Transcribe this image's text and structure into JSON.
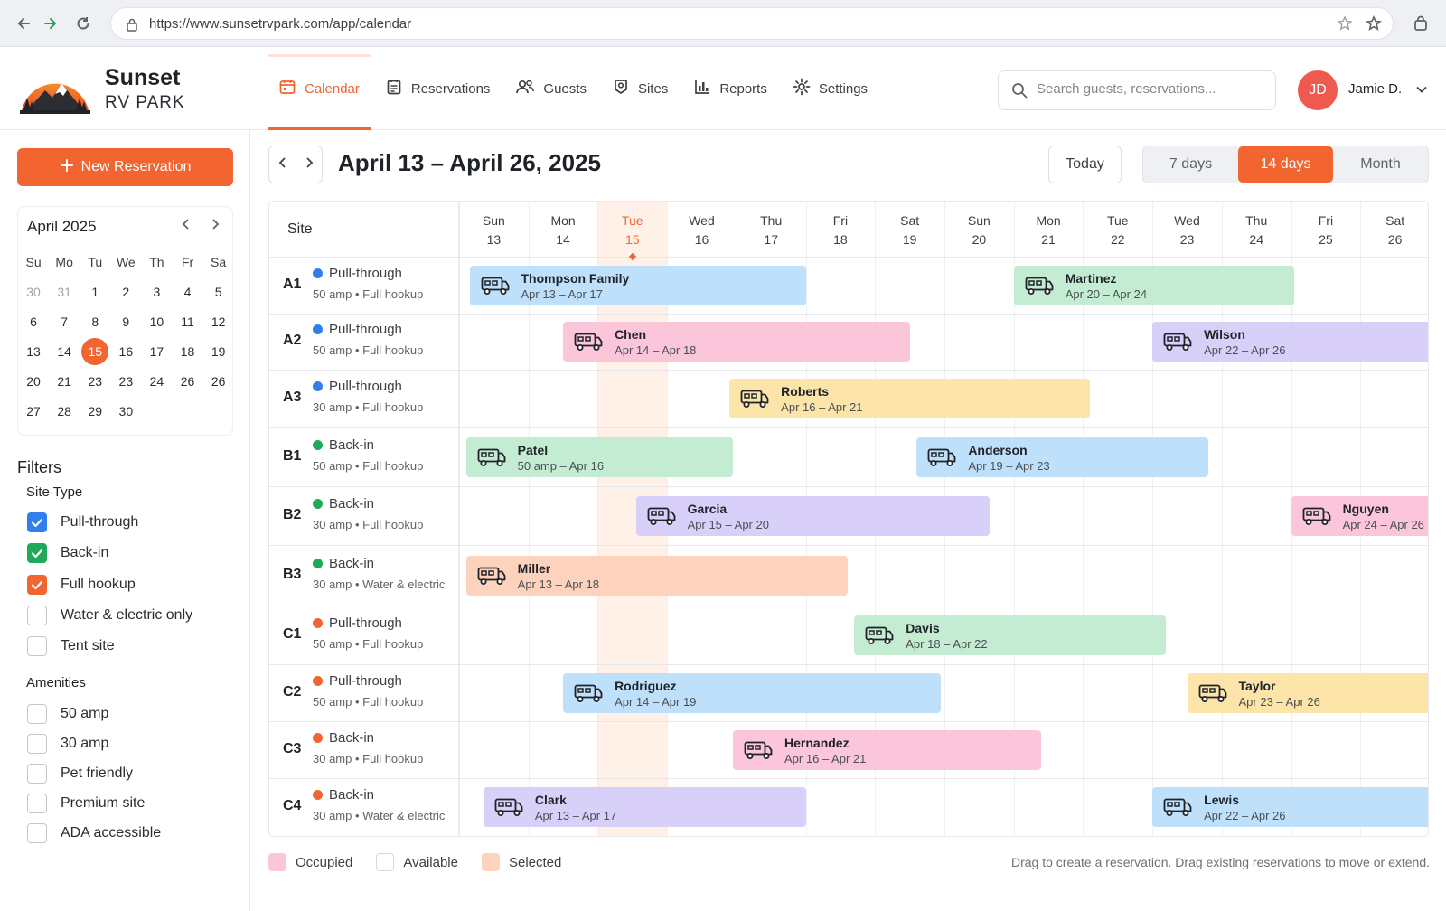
{
  "browser": {
    "url": "https://www.sunsetrvpark.com/app/calendar"
  },
  "brand": {
    "line1": "Sunset",
    "line2": "RV PARK"
  },
  "nav": {
    "tabs": [
      {
        "label": "Calendar",
        "icon": "calendar-icon",
        "active": true
      },
      {
        "label": "Reservations",
        "icon": "clipboard-icon"
      },
      {
        "label": "Guests",
        "icon": "users-icon"
      },
      {
        "label": "Sites",
        "icon": "map-pin-icon"
      },
      {
        "label": "Reports",
        "icon": "bar-chart-icon"
      },
      {
        "label": "Settings",
        "icon": "gear-icon"
      }
    ]
  },
  "search": {
    "placeholder": "Search guests, reservations..."
  },
  "user": {
    "initials": "JD",
    "name": "Jamie D."
  },
  "sidebar": {
    "new_reservation": "New Reservation",
    "mini_calendar": {
      "title": "April 2025",
      "weekdays": [
        "Su",
        "Mo",
        "Tu",
        "We",
        "Th",
        "Fr",
        "Sa"
      ],
      "weeks": [
        [
          "30",
          "31",
          "1",
          "2",
          "3",
          "4",
          "5"
        ],
        [
          "6",
          "7",
          "8",
          "9",
          "10",
          "11",
          "12"
        ],
        [
          "13",
          "14",
          "15",
          "16",
          "17",
          "18",
          "19"
        ],
        [
          "20",
          "21",
          "23",
          "23",
          "24",
          "26",
          "26"
        ],
        [
          "27",
          "28",
          "29",
          "30",
          "",
          "",
          ""
        ]
      ],
      "selected": "15"
    },
    "filters_title": "Filters",
    "site_type_title": "Site Type",
    "site_types": [
      {
        "label": "Pull-through",
        "checked": true,
        "color": "#2f80ed"
      },
      {
        "label": "Back-in",
        "checked": true,
        "color": "#1faa59"
      },
      {
        "label": "Full hookup",
        "checked": true,
        "color": "#f26430"
      },
      {
        "label": "Water & electric only",
        "checked": false
      },
      {
        "label": "Tent site",
        "checked": false
      }
    ],
    "amenities_title": "Amenities",
    "amenities": [
      {
        "label": "50 amp",
        "checked": false
      },
      {
        "label": "30 amp",
        "checked": false
      },
      {
        "label": "Pet friendly",
        "checked": false
      },
      {
        "label": "Premium site",
        "checked": false
      },
      {
        "label": "ADA accessible",
        "checked": false
      }
    ]
  },
  "calendar": {
    "range_title": "April 13 – April 26, 2025",
    "today_label": "Today",
    "views": [
      {
        "label": "7 days"
      },
      {
        "label": "14 days",
        "active": true
      },
      {
        "label": "Month"
      }
    ],
    "site_header": "Site",
    "days": [
      {
        "dow": "Sun",
        "date": "13"
      },
      {
        "dow": "Mon",
        "date": "14"
      },
      {
        "dow": "Tue",
        "date": "15",
        "today": true
      },
      {
        "dow": "Wed",
        "date": "16"
      },
      {
        "dow": "Thu",
        "date": "17"
      },
      {
        "dow": "Fri",
        "date": "18"
      },
      {
        "dow": "Sat",
        "date": "19"
      },
      {
        "dow": "Sun",
        "date": "20"
      },
      {
        "dow": "Mon",
        "date": "21"
      },
      {
        "dow": "Tue",
        "date": "22"
      },
      {
        "dow": "Wed",
        "date": "23"
      },
      {
        "dow": "Thu",
        "date": "24"
      },
      {
        "dow": "Fri",
        "date": "25"
      },
      {
        "dow": "Sat",
        "date": "26"
      }
    ],
    "sites": [
      {
        "code": "A1",
        "type": "Pull-through",
        "dot": "#2f80ed",
        "spec": "50 amp • Full hookup",
        "reservations": [
          {
            "name": "Thompson Family",
            "dates": "Apr 13 – Apr 17",
            "color": "#bfe0fb"
          },
          {
            "name": "Martinez",
            "dates": "Apr 20 – Apr 24",
            "color": "#c4ecd2"
          }
        ]
      },
      {
        "code": "A2",
        "type": "Pull-through",
        "dot": "#2f80ed",
        "spec": "50 amp • Full hookup",
        "reservations": [
          {
            "name": "Chen",
            "dates": "Apr 14 – Apr 18",
            "color": "#fbc6da"
          },
          {
            "name": "Wilson",
            "dates": "Apr 22 – Apr 26",
            "color": "#d9d0fa"
          }
        ]
      },
      {
        "code": "A3",
        "type": "Pull-through",
        "dot": "#2f80ed",
        "spec": "30 amp • Full hookup",
        "reservations": [
          {
            "name": "Roberts",
            "dates": "Apr 16 – Apr 21",
            "color": "#fde4a8"
          }
        ]
      },
      {
        "code": "B1",
        "type": "Back-in",
        "dot": "#1faa59",
        "spec": "50 amp • Full hookup",
        "reservations": [
          {
            "name": "Patel",
            "dates": "50 amp – Apr 16",
            "color": "#c4ecd2"
          },
          {
            "name": "Anderson",
            "dates": "Apr 19 – Apr 23",
            "color": "#bfe0fb"
          }
        ]
      },
      {
        "code": "B2",
        "type": "Back-in",
        "dot": "#1faa59",
        "spec": "30 amp • Full hookup",
        "reservations": [
          {
            "name": "Garcia",
            "dates": "Apr 15 – Apr 20",
            "color": "#d9d0fa"
          },
          {
            "name": "Nguyen",
            "dates": "Apr 24 – Apr 26",
            "color": "#fbc6da"
          }
        ]
      },
      {
        "code": "B3",
        "type": "Back-in",
        "dot": "#1faa59",
        "spec": "30 amp • Water & electric",
        "reservations": [
          {
            "name": "Miller",
            "dates": "Apr 13 – Apr 18",
            "color": "#fdd3bd"
          }
        ]
      },
      {
        "code": "C1",
        "type": "Pull-through",
        "dot": "#f26430",
        "spec": "50 amp • Full hookup",
        "reservations": [
          {
            "name": "Davis",
            "dates": "Apr 18 – Apr 22",
            "color": "#c4ecd2"
          }
        ]
      },
      {
        "code": "C2",
        "type": "Pull-through",
        "dot": "#f26430",
        "spec": "50 amp • Full hookup",
        "reservations": [
          {
            "name": "Rodriguez",
            "dates": "Apr 14 – Apr 19",
            "color": "#bfe0fb"
          },
          {
            "name": "Taylor",
            "dates": "Apr 23 – Apr 26",
            "color": "#fde4a8"
          }
        ]
      },
      {
        "code": "C3",
        "type": "Back-in",
        "dot": "#f26430",
        "spec": "30 amp • Full hookup",
        "reservations": [
          {
            "name": "Hernandez",
            "dates": "Apr 16 – Apr 21",
            "color": "#fbc6da"
          }
        ]
      },
      {
        "code": "C4",
        "type": "Back-in",
        "dot": "#f26430",
        "spec": "30 amp • Water & electric",
        "reservations": [
          {
            "name": "Clark",
            "dates": "Apr 13 – Apr 17",
            "color": "#d9d0fa"
          },
          {
            "name": "Lewis",
            "dates": "Apr 22 – Apr 26",
            "color": "#bfe0fb"
          }
        ]
      }
    ]
  },
  "legend": [
    {
      "label": "Occupied",
      "color": "#fbc6da"
    },
    {
      "label": "Available",
      "color": "#ffffff"
    },
    {
      "label": "Selected",
      "color": "#fdd3bd"
    }
  ],
  "hint": "Drag to create a reservation. Drag existing reservations to move or extend.",
  "colors": {
    "accent": "#f26430"
  }
}
